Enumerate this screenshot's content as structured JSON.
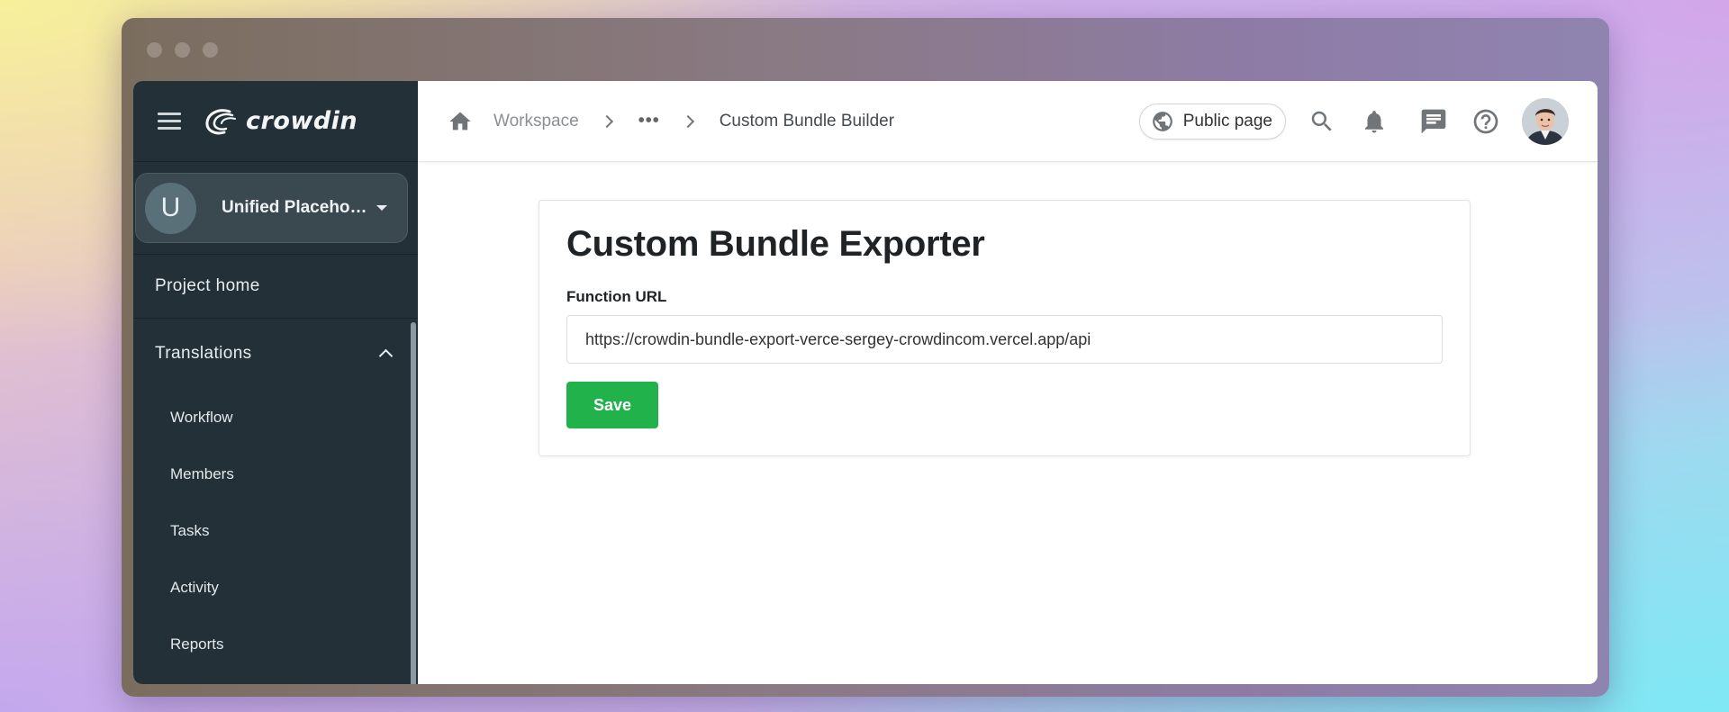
{
  "app": {
    "logo_text": "crowdin",
    "icons": [
      "menu-icon",
      "crowdin-logo-icon",
      "home-icon",
      "globe-icon",
      "search-icon",
      "bell-icon",
      "chat-icon",
      "help-icon"
    ],
    "colors": {
      "sidebar_bg": "#233038",
      "accent_green": "#22b24c"
    }
  },
  "sidebar": {
    "project": {
      "initial": "U",
      "name": "Unified Placeholder"
    },
    "project_home": "Project home",
    "section": {
      "label": "Translations",
      "expanded": true
    },
    "items": [
      {
        "label": "Workflow"
      },
      {
        "label": "Members"
      },
      {
        "label": "Tasks"
      },
      {
        "label": "Activity"
      },
      {
        "label": "Reports"
      }
    ]
  },
  "header": {
    "breadcrumb": {
      "workspace": "Workspace",
      "ellipsis": "•••",
      "current": "Custom Bundle Builder"
    },
    "public_page_label": "Public page"
  },
  "main": {
    "title": "Custom Bundle Exporter",
    "field_label": "Function URL",
    "function_url": "https://crowdin-bundle-export-verce-sergey-crowdincom.vercel.app/api",
    "save_label": "Save"
  }
}
